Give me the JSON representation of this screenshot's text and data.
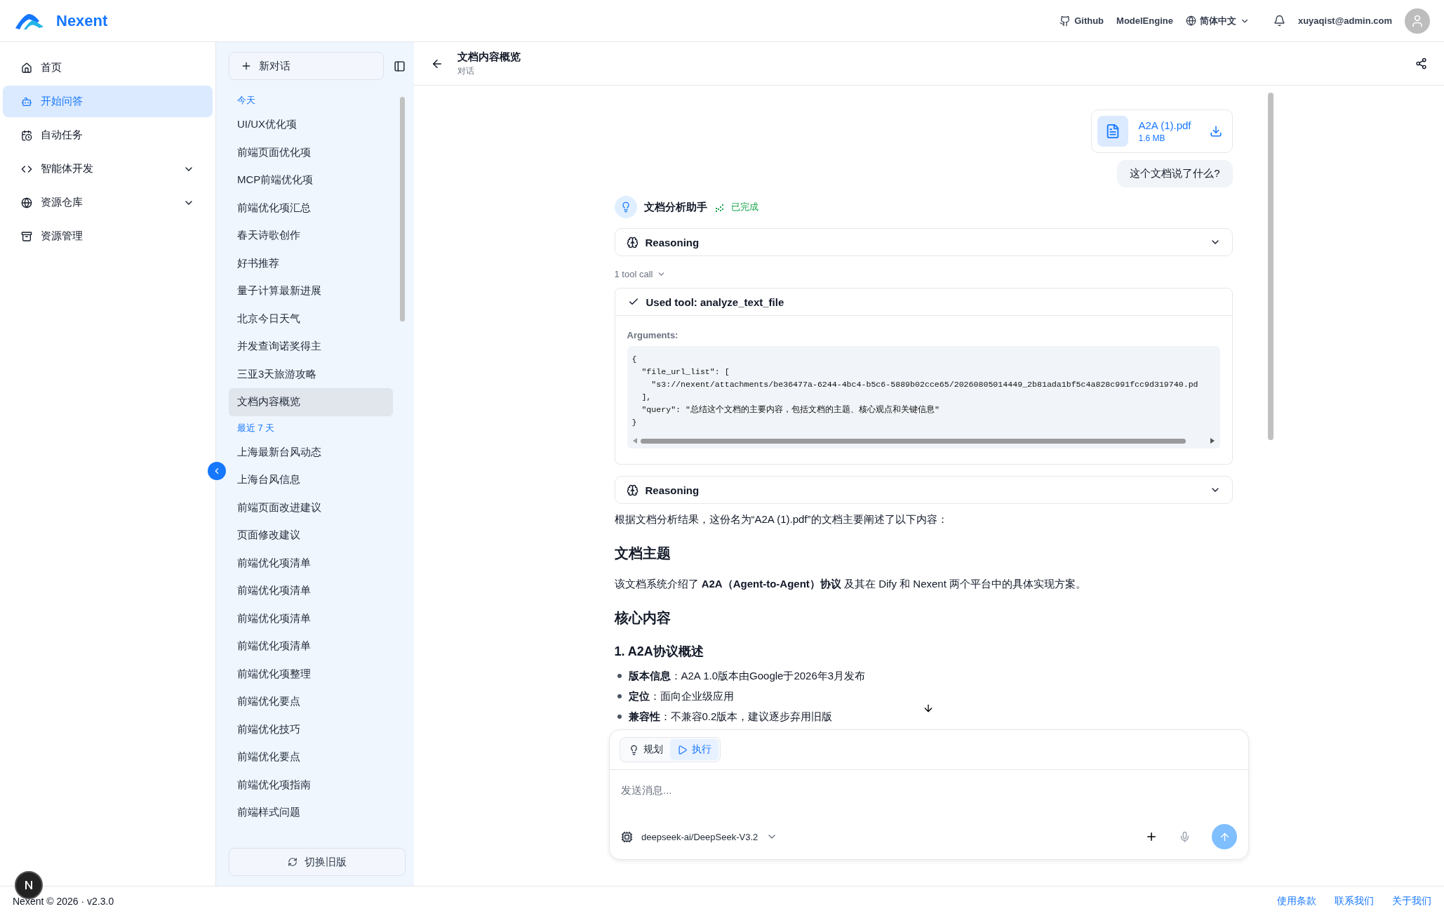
{
  "header": {
    "brand": "Nexent",
    "links": [
      {
        "kind": "github",
        "label": "Github"
      },
      {
        "kind": "plain",
        "label": "ModelEngine"
      }
    ],
    "language": "简体中文",
    "user": "xuyaqist@admin.com"
  },
  "nav": [
    {
      "label": "首页",
      "kind": "link",
      "selected": false
    },
    {
      "label": "开始问答",
      "kind": "link",
      "selected": true
    },
    {
      "label": "自动任务",
      "kind": "link",
      "selected": false
    },
    {
      "label": "智能体开发",
      "kind": "group",
      "selected": false
    },
    {
      "label": "资源仓库",
      "kind": "group",
      "selected": false
    },
    {
      "label": "资源管理",
      "kind": "link",
      "selected": false
    }
  ],
  "conversations": {
    "new_chat": "新对话",
    "groups": [
      {
        "title": "今天",
        "items": [
          {
            "label": "UI/UX优化项",
            "selected": false
          },
          {
            "label": "前端页面优化项",
            "selected": false
          },
          {
            "label": "MCP前端优化项",
            "selected": false
          },
          {
            "label": "前端优化项汇总",
            "selected": false
          },
          {
            "label": "春天诗歌创作",
            "selected": false
          },
          {
            "label": "好书推荐",
            "selected": false
          },
          {
            "label": "量子计算最新进展",
            "selected": false
          },
          {
            "label": "北京今日天气",
            "selected": false
          },
          {
            "label": "并发查询诺奖得主",
            "selected": false
          },
          {
            "label": "三亚3天旅游攻略",
            "selected": false
          },
          {
            "label": "文档内容概览",
            "selected": true
          }
        ]
      },
      {
        "title": "最近 7 天",
        "items": [
          {
            "label": "上海最新台风动态",
            "selected": false
          },
          {
            "label": "上海台风信息",
            "selected": false
          },
          {
            "label": "前端页面改进建议",
            "selected": false
          },
          {
            "label": "页面修改建议",
            "selected": false
          },
          {
            "label": "前端优化项清单",
            "selected": false
          },
          {
            "label": "前端优化项清单",
            "selected": false
          },
          {
            "label": "前端优化项清单",
            "selected": false
          },
          {
            "label": "前端优化项清单",
            "selected": false
          },
          {
            "label": "前端优化项整理",
            "selected": false
          },
          {
            "label": "前端优化要点",
            "selected": false
          },
          {
            "label": "前端优化技巧",
            "selected": false
          },
          {
            "label": "前端优化要点",
            "selected": false
          },
          {
            "label": "前端优化项指南",
            "selected": false
          },
          {
            "label": "前端样式问题",
            "selected": false
          }
        ]
      }
    ],
    "switch_button": "切换旧版"
  },
  "chat": {
    "title": "文档内容概览",
    "subtitle": "对话",
    "attachment": {
      "name": "A2A (1).pdf",
      "size": "1.6 MB"
    },
    "question": "这个文档说了什么?",
    "assistant": {
      "name": "文档分析助手",
      "status": "已完成"
    },
    "reasoning_label": "Reasoning",
    "tool_calls": "1 tool call",
    "tool": {
      "label": "Used tool: analyze_text_file",
      "arguments_label": "Arguments:",
      "code": [
        "{",
        "  \"file_url_list\": [",
        "    \"s3://nexent/attachments/be36477a-6244-4bc4-b5c6-5889b02cce65/20260805014449_2b81ada1bf5c4a828c991fcc9d319740.pd",
        "  ],",
        "  \"query\": \"总结这个文档的主要内容，包括文档的主题、核心观点和关键信息\"",
        "}"
      ]
    },
    "reasoning_label_2": "Reasoning",
    "answer": [
      {
        "kind": "paragraph",
        "text": "根据文档分析结果，这份名为“A2A (1).pdf”的文档主要阐述了以下内容："
      },
      {
        "kind": "h2",
        "text": "文档主题"
      },
      {
        "kind": "paragraph",
        "text": "该文档系统介绍了 **A2A（Agent-to-Agent）协议** 及其在 Dify 和 Nexent 两个平台中的具体实现方案。"
      },
      {
        "kind": "h2",
        "text": "核心内容"
      },
      {
        "kind": "h3",
        "text": "1. A2A协议概述"
      },
      {
        "kind": "bullet",
        "text": "**版本信息**：A2A 1.0版本由Google于2026年3月发布"
      },
      {
        "kind": "bullet",
        "text": "**定位**：面向企业级应用"
      },
      {
        "kind": "bullet",
        "text": "**兼容性**：不兼容0.2版本，建议逐步弃用旧版"
      }
    ]
  },
  "composer": {
    "modes": [
      {
        "label": "规划",
        "kind": "plan",
        "selected": false
      },
      {
        "label": "执行",
        "kind": "run",
        "selected": true
      }
    ],
    "placeholder": "发送消息...",
    "model": "deepseek-ai/DeepSeek-V3.2"
  },
  "footer": {
    "copyright": "Nexent © 2026 · v2.3.0",
    "links": [
      "使用条款",
      "联系我们",
      "关于我们"
    ]
  }
}
